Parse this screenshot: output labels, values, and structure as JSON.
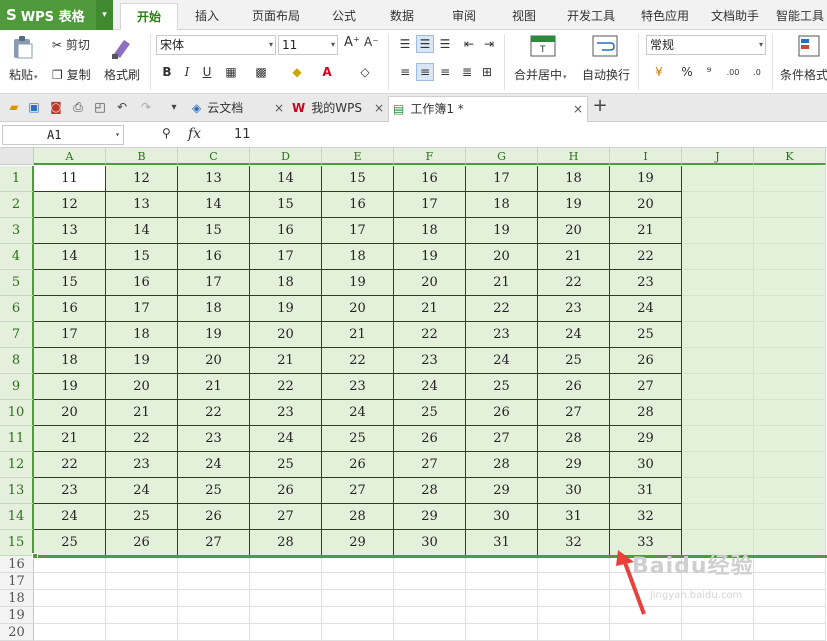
{
  "app": {
    "name": "WPS 表格",
    "logo": "S",
    "menu_tabs": [
      "开始",
      "插入",
      "页面布局",
      "公式",
      "数据",
      "审阅",
      "视图",
      "开发工具",
      "特色应用",
      "文档助手",
      "智能工具"
    ],
    "active_tab": "开始"
  },
  "ribbon": {
    "paste": "粘贴",
    "cut": "剪切",
    "copy": "复制",
    "format_painter": "格式刷",
    "font_name": "宋体",
    "font_size": "11",
    "grow_font": "A⁺",
    "shrink_font": "A⁻",
    "bold": "B",
    "italic": "I",
    "underline": "U",
    "merge_center": "合并居中",
    "wrap_text": "自动换行",
    "number_format": "常规",
    "percent": "%",
    "thousands": "⁹",
    "conditional_format": "条件格式"
  },
  "tabs": [
    {
      "label": "云文档",
      "icon": "cloud-doc-icon"
    },
    {
      "label": "我的WPS",
      "icon": "wps-logo-icon"
    },
    {
      "label": "工作簿1 *",
      "icon": "workbook-icon",
      "active": true
    }
  ],
  "formula_bar": {
    "cell_ref": "A1",
    "fx": "fx",
    "value": "11"
  },
  "sheet": {
    "columns": [
      "A",
      "B",
      "C",
      "D",
      "E",
      "F",
      "G",
      "H",
      "I",
      "J",
      "K"
    ],
    "rows": [
      "1",
      "2",
      "3",
      "4",
      "5",
      "6",
      "7",
      "8",
      "9",
      "10",
      "11",
      "12",
      "13",
      "14",
      "15",
      "16",
      "17",
      "18",
      "19",
      "20"
    ],
    "data": [
      [
        "11",
        "12",
        "13",
        "14",
        "15",
        "16",
        "17",
        "18",
        "19"
      ],
      [
        "12",
        "13",
        "14",
        "15",
        "16",
        "17",
        "18",
        "19",
        "20"
      ],
      [
        "13",
        "14",
        "15",
        "16",
        "17",
        "18",
        "19",
        "20",
        "21"
      ],
      [
        "14",
        "15",
        "16",
        "17",
        "18",
        "19",
        "20",
        "21",
        "22"
      ],
      [
        "15",
        "16",
        "17",
        "18",
        "19",
        "20",
        "21",
        "22",
        "23"
      ],
      [
        "16",
        "17",
        "18",
        "19",
        "20",
        "21",
        "22",
        "23",
        "24"
      ],
      [
        "17",
        "18",
        "19",
        "20",
        "21",
        "22",
        "23",
        "24",
        "25"
      ],
      [
        "18",
        "19",
        "20",
        "21",
        "22",
        "23",
        "24",
        "25",
        "26"
      ],
      [
        "19",
        "20",
        "21",
        "22",
        "23",
        "24",
        "25",
        "26",
        "27"
      ],
      [
        "20",
        "21",
        "22",
        "23",
        "24",
        "25",
        "26",
        "27",
        "28"
      ],
      [
        "21",
        "22",
        "23",
        "24",
        "25",
        "26",
        "27",
        "28",
        "29"
      ],
      [
        "22",
        "23",
        "24",
        "25",
        "26",
        "27",
        "28",
        "29",
        "30"
      ],
      [
        "23",
        "24",
        "25",
        "26",
        "27",
        "28",
        "29",
        "30",
        "31"
      ],
      [
        "24",
        "25",
        "26",
        "27",
        "28",
        "29",
        "30",
        "31",
        "32"
      ],
      [
        "25",
        "26",
        "27",
        "28",
        "29",
        "30",
        "31",
        "32",
        "33"
      ]
    ],
    "selected_rows": 15,
    "active_cell": "A1"
  },
  "watermark": {
    "text": "Baidu经验",
    "url": "jingyan.baidu.com"
  },
  "colors": {
    "accent": "#4f9a3c",
    "selection": "#e3f1da",
    "arrow": "#e8413c"
  }
}
